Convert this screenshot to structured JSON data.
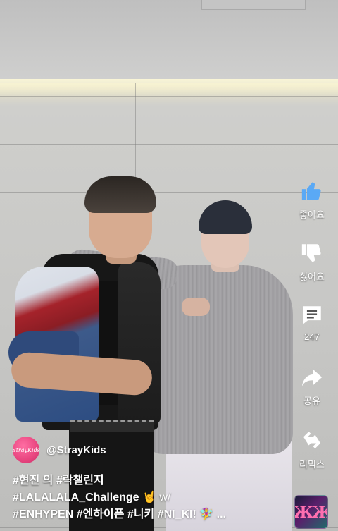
{
  "rail": {
    "like_label": "좋아요",
    "dislike_label": "싫어요",
    "comments_count": "247",
    "share_label": "공유",
    "remix_label": "리믹스"
  },
  "channel": {
    "name": "@StrayKids",
    "avatar_text": "StrayKids"
  },
  "caption": {
    "line1": "#현진 의 #락챌린지",
    "line2_main": "#LALALALA_Challenge 🤘 ",
    "line2_tail": "w/",
    "line3": "#ENHYPEN #엔하이픈 #니키 #NI_KI! 🧚‍♀️ ..."
  },
  "colors": {
    "like_blue": "#5aa9f5",
    "avatar_pink": "#e8457f",
    "text": "#ffffff"
  },
  "icons": [
    "thumbs-up-icon",
    "thumbs-down-icon",
    "comment-icon",
    "share-icon",
    "remix-icon"
  ]
}
